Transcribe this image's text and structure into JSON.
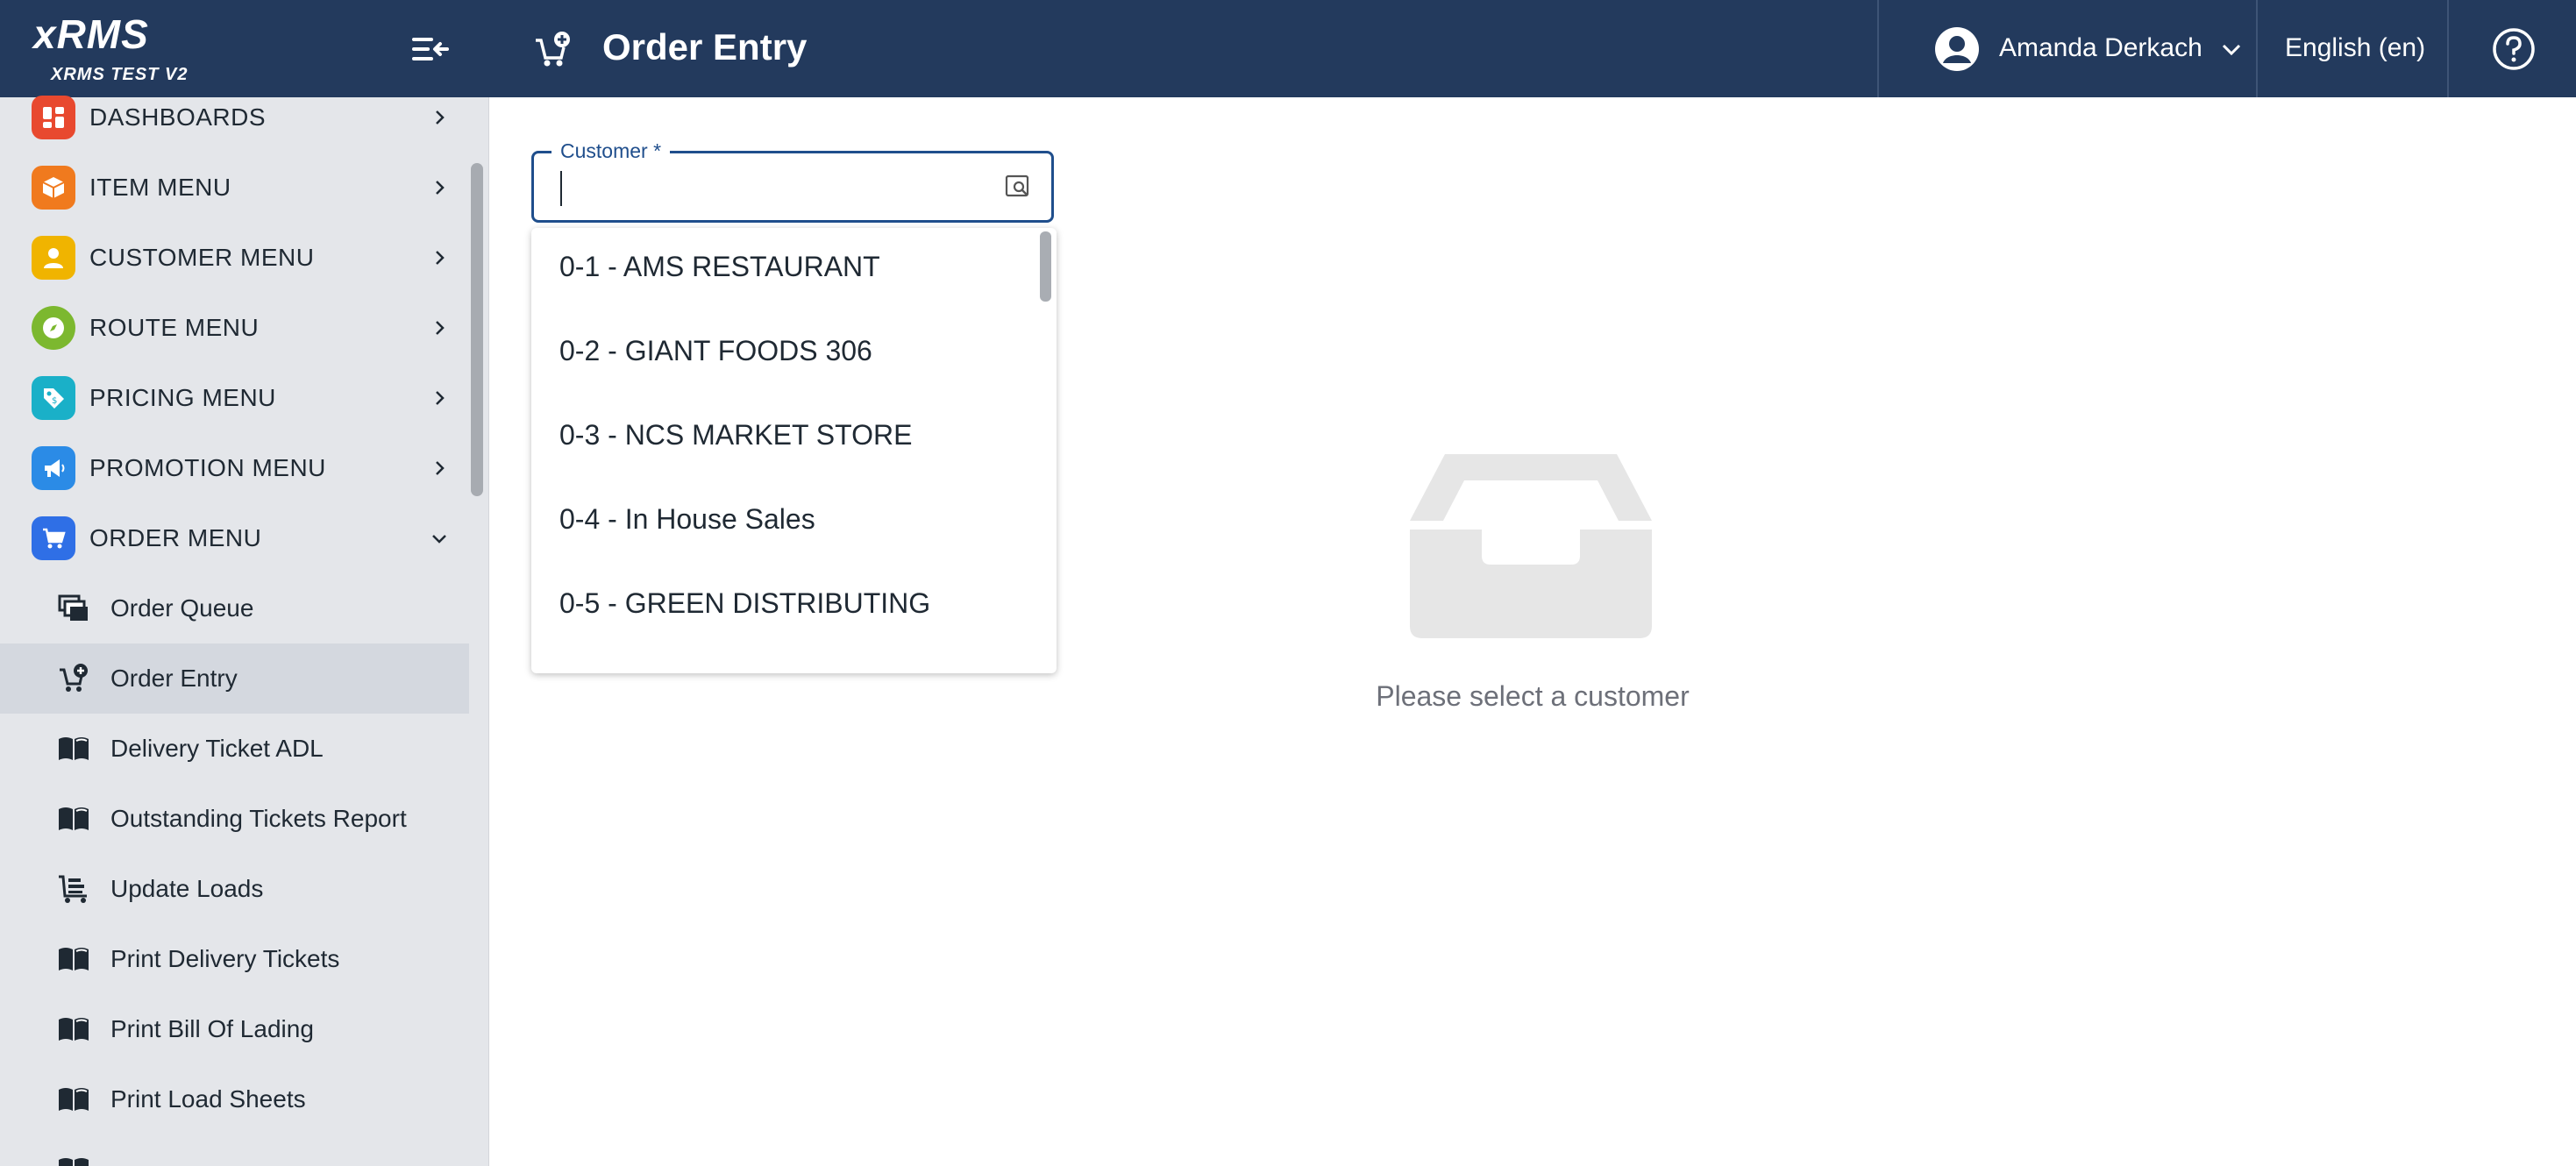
{
  "brand": {
    "title": "xRMS",
    "subtitle": "XRMS TEST V2"
  },
  "header": {
    "page_title": "Order Entry",
    "user_name": "Amanda Derkach",
    "language": "English (en)"
  },
  "sidebar": {
    "menus": [
      {
        "label": "DASHBOARDS",
        "color": "#e8492f",
        "icon": "dashboard-icon"
      },
      {
        "label": "ITEM MENU",
        "color": "#f07a1e",
        "icon": "box-icon"
      },
      {
        "label": "CUSTOMER MENU",
        "color": "#f0b400",
        "icon": "person-icon"
      },
      {
        "label": "ROUTE MENU",
        "color": "#7cb82f",
        "icon": "compass-icon"
      },
      {
        "label": "PRICING MENU",
        "color": "#1ab0c8",
        "icon": "price-tag-icon"
      },
      {
        "label": "PROMOTION MENU",
        "color": "#2b8be6",
        "icon": "megaphone-icon"
      },
      {
        "label": "ORDER MENU",
        "color": "#2f6fe6",
        "icon": "cart-icon"
      }
    ],
    "order_items": [
      {
        "label": "Order Queue",
        "icon": "queue-icon"
      },
      {
        "label": "Order Entry",
        "icon": "cart-add-icon"
      },
      {
        "label": "Delivery Ticket ADL",
        "icon": "book-icon"
      },
      {
        "label": "Outstanding Tickets Report",
        "icon": "book-icon"
      },
      {
        "label": "Update Loads",
        "icon": "cart-load-icon"
      },
      {
        "label": "Print Delivery Tickets",
        "icon": "book-icon"
      },
      {
        "label": "Print Bill Of Lading",
        "icon": "book-icon"
      },
      {
        "label": "Print Load Sheets",
        "icon": "book-icon"
      }
    ]
  },
  "customer_field": {
    "label": "Customer *",
    "value": "",
    "options": [
      "0-1 - AMS RESTAURANT",
      "0-2 - GIANT FOODS 306",
      "0-3 - NCS MARKET STORE",
      "0-4 - In House Sales",
      "0-5 - GREEN DISTRIBUTING"
    ]
  },
  "empty_state": {
    "message": "Please select a customer"
  },
  "colors": {
    "header_bg": "#233a5d",
    "accent": "#1f4e8c"
  }
}
